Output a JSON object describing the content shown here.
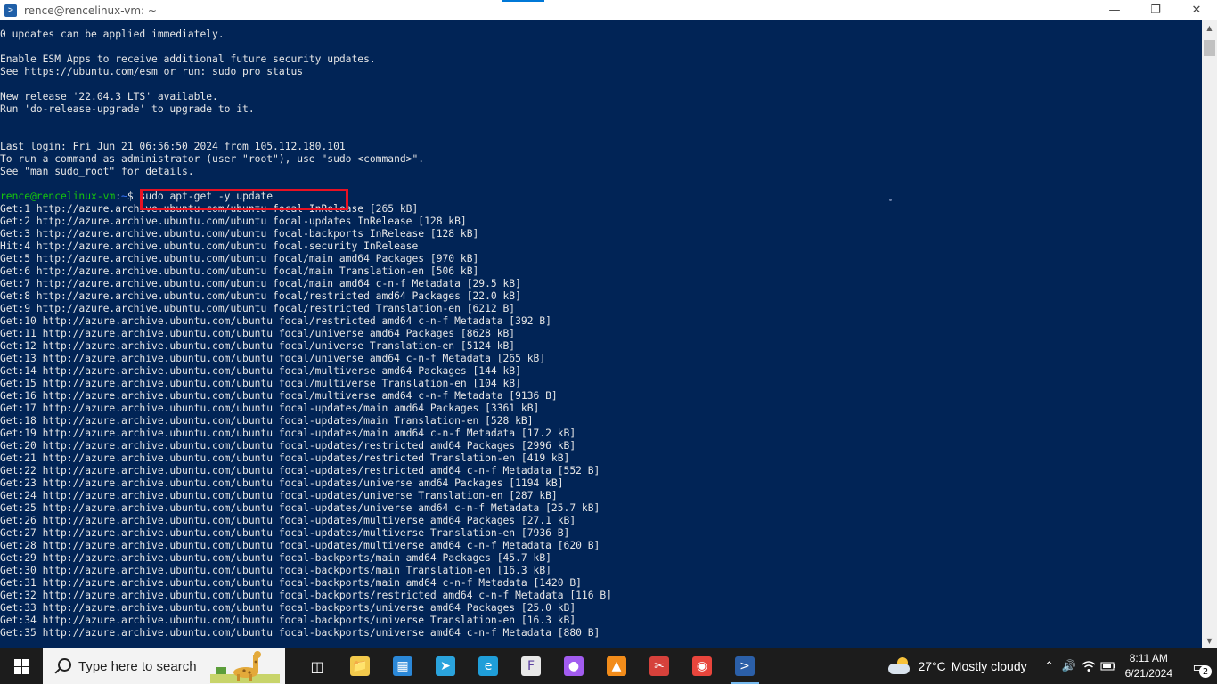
{
  "window": {
    "title": "rence@rencelinux-vm: ~",
    "minimize_icon": "minimize-icon",
    "maximize_icon": "restore-icon",
    "close_icon": "close-icon"
  },
  "terminal": {
    "colors": {
      "background": "#012456",
      "text": "#e6e6e6",
      "prompt_user": "#16c60c",
      "prompt_path": "#3b78ff",
      "highlight": "#e81123"
    },
    "pre_lines": [
      "0 updates can be applied immediately.",
      "",
      "Enable ESM Apps to receive additional future security updates.",
      "See https://ubuntu.com/esm or run: sudo pro status",
      "",
      "New release '22.04.3 LTS' available.",
      "Run 'do-release-upgrade' to upgrade to it.",
      "",
      "",
      "Last login: Fri Jun 21 06:56:50 2024 from 105.112.180.101",
      "To run a command as administrator (user \"root\"), use \"sudo <command>\".",
      "See \"man sudo_root\" for details.",
      ""
    ],
    "prompt": {
      "user_host": "rence@rencelinux-vm",
      "path": "~",
      "symbol": "$",
      "command": "sudo apt-get -y update"
    },
    "post_lines": [
      "Get:1 http://azure.archive.ubuntu.com/ubuntu focal InRelease [265 kB]",
      "Get:2 http://azure.archive.ubuntu.com/ubuntu focal-updates InRelease [128 kB]",
      "Get:3 http://azure.archive.ubuntu.com/ubuntu focal-backports InRelease [128 kB]",
      "Hit:4 http://azure.archive.ubuntu.com/ubuntu focal-security InRelease",
      "Get:5 http://azure.archive.ubuntu.com/ubuntu focal/main amd64 Packages [970 kB]",
      "Get:6 http://azure.archive.ubuntu.com/ubuntu focal/main Translation-en [506 kB]",
      "Get:7 http://azure.archive.ubuntu.com/ubuntu focal/main amd64 c-n-f Metadata [29.5 kB]",
      "Get:8 http://azure.archive.ubuntu.com/ubuntu focal/restricted amd64 Packages [22.0 kB]",
      "Get:9 http://azure.archive.ubuntu.com/ubuntu focal/restricted Translation-en [6212 B]",
      "Get:10 http://azure.archive.ubuntu.com/ubuntu focal/restricted amd64 c-n-f Metadata [392 B]",
      "Get:11 http://azure.archive.ubuntu.com/ubuntu focal/universe amd64 Packages [8628 kB]",
      "Get:12 http://azure.archive.ubuntu.com/ubuntu focal/universe Translation-en [5124 kB]",
      "Get:13 http://azure.archive.ubuntu.com/ubuntu focal/universe amd64 c-n-f Metadata [265 kB]",
      "Get:14 http://azure.archive.ubuntu.com/ubuntu focal/multiverse amd64 Packages [144 kB]",
      "Get:15 http://azure.archive.ubuntu.com/ubuntu focal/multiverse Translation-en [104 kB]",
      "Get:16 http://azure.archive.ubuntu.com/ubuntu focal/multiverse amd64 c-n-f Metadata [9136 B]",
      "Get:17 http://azure.archive.ubuntu.com/ubuntu focal-updates/main amd64 Packages [3361 kB]",
      "Get:18 http://azure.archive.ubuntu.com/ubuntu focal-updates/main Translation-en [528 kB]",
      "Get:19 http://azure.archive.ubuntu.com/ubuntu focal-updates/main amd64 c-n-f Metadata [17.2 kB]",
      "Get:20 http://azure.archive.ubuntu.com/ubuntu focal-updates/restricted amd64 Packages [2996 kB]",
      "Get:21 http://azure.archive.ubuntu.com/ubuntu focal-updates/restricted Translation-en [419 kB]",
      "Get:22 http://azure.archive.ubuntu.com/ubuntu focal-updates/restricted amd64 c-n-f Metadata [552 B]",
      "Get:23 http://azure.archive.ubuntu.com/ubuntu focal-updates/universe amd64 Packages [1194 kB]",
      "Get:24 http://azure.archive.ubuntu.com/ubuntu focal-updates/universe Translation-en [287 kB]",
      "Get:25 http://azure.archive.ubuntu.com/ubuntu focal-updates/universe amd64 c-n-f Metadata [25.7 kB]",
      "Get:26 http://azure.archive.ubuntu.com/ubuntu focal-updates/multiverse amd64 Packages [27.1 kB]",
      "Get:27 http://azure.archive.ubuntu.com/ubuntu focal-updates/multiverse Translation-en [7936 B]",
      "Get:28 http://azure.archive.ubuntu.com/ubuntu focal-updates/multiverse amd64 c-n-f Metadata [620 B]",
      "Get:29 http://azure.archive.ubuntu.com/ubuntu focal-backports/main amd64 Packages [45.7 kB]",
      "Get:30 http://azure.archive.ubuntu.com/ubuntu focal-backports/main Translation-en [16.3 kB]",
      "Get:31 http://azure.archive.ubuntu.com/ubuntu focal-backports/main amd64 c-n-f Metadata [1420 B]",
      "Get:32 http://azure.archive.ubuntu.com/ubuntu focal-backports/restricted amd64 c-n-f Metadata [116 B]",
      "Get:33 http://azure.archive.ubuntu.com/ubuntu focal-backports/universe amd64 Packages [25.0 kB]",
      "Get:34 http://azure.archive.ubuntu.com/ubuntu focal-backports/universe Translation-en [16.3 kB]",
      "Get:35 http://azure.archive.ubuntu.com/ubuntu focal-backports/universe amd64 c-n-f Metadata [880 B]"
    ]
  },
  "scrollbar": {
    "up_icon": "scroll-up-icon",
    "down_icon": "scroll-down-icon"
  },
  "taskbar": {
    "search_placeholder": "Type here to search",
    "apps": [
      {
        "name": "task-view-icon",
        "bg": "transparent"
      },
      {
        "name": "file-explorer-icon",
        "bg": "#f2c94c"
      },
      {
        "name": "microsoft-store-icon",
        "bg": "#2b88d8"
      },
      {
        "name": "telegram-icon",
        "bg": "#2aa3dd"
      },
      {
        "name": "edge-icon",
        "bg": "#1f9ed9"
      },
      {
        "name": "app-f-icon",
        "bg": "#e8e8e8"
      },
      {
        "name": "paint-drop-icon",
        "bg": "#a25cf0"
      },
      {
        "name": "vlc-icon",
        "bg": "#f28c1a"
      },
      {
        "name": "snipping-tool-icon",
        "bg": "#d6413b"
      },
      {
        "name": "chrome-icon",
        "bg": "#e8453c"
      },
      {
        "name": "powershell-icon",
        "bg": "#2b5fa8"
      }
    ],
    "weather": {
      "temp": "27°C",
      "condition": "Mostly cloudy"
    },
    "clock": {
      "time": "8:11 AM",
      "date": "6/21/2024"
    },
    "notifications_count": "2"
  }
}
